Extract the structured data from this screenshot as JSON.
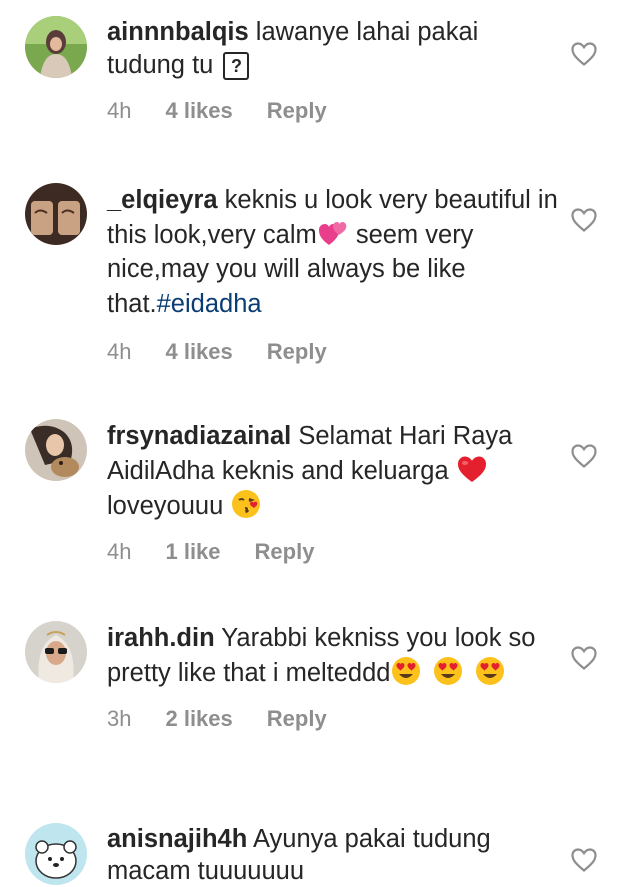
{
  "comments": [
    {
      "username": "ainnnbalqis",
      "text_before": " lawanye lahai pakai tudung tu ",
      "time": "4h",
      "likes": "4 likes",
      "reply": "Reply"
    },
    {
      "username": "_elqieyra",
      "text_before": " keknis u look very beautiful in this look,very calm",
      "text_after": " seem very nice,may you will always be like that.",
      "hashtag": "#eidadha",
      "time": "4h",
      "likes": "4 likes",
      "reply": "Reply"
    },
    {
      "username": "frsynadiazainal",
      "text_before": " Selamat Hari Raya AidilAdha keknis and keluarga ",
      "text_after": "  loveyouuu ",
      "time": "4h",
      "likes": "1 like",
      "reply": "Reply"
    },
    {
      "username": "irahh.din",
      "text_before": " Yarabbi kekniss you look so pretty like that i melteddd",
      "time": "3h",
      "likes": "2 likes",
      "reply": "Reply"
    },
    {
      "username": "anisnajih4h",
      "text_before": " Ayunya pakai tudung macam tuuuuuuu"
    }
  ],
  "icons": {
    "like": "heart-outline-icon",
    "placeholder_glyph": "?"
  },
  "colors": {
    "text": "#262626",
    "muted": "#8e8e8e",
    "hashtag": "#0b3d75",
    "heart_stroke": "#8e8e8e"
  }
}
